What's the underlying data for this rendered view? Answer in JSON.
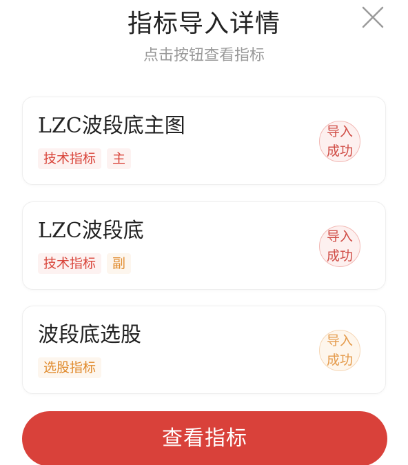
{
  "header": {
    "title": "指标导入详情",
    "subtitle": "点击按钮查看指标"
  },
  "indicators": [
    {
      "name": "LZC波段底主图",
      "tags": [
        "技术指标",
        "主"
      ],
      "status_line1": "导入",
      "status_line2": "成功",
      "accent": "#d9453b"
    },
    {
      "name": "LZC波段底",
      "tags": [
        "技术指标",
        "副"
      ],
      "status_line1": "导入",
      "status_line2": "成功",
      "accent": "#d9453b"
    },
    {
      "name": "波段底选股",
      "tags": [
        "选股指标"
      ],
      "status_line1": "导入",
      "status_line2": "成功",
      "accent": "#e08a2c"
    }
  ],
  "footer": {
    "view_button_label": "查看指标",
    "button_color": "#d9413a"
  },
  "icons": {
    "close": "close-icon"
  }
}
